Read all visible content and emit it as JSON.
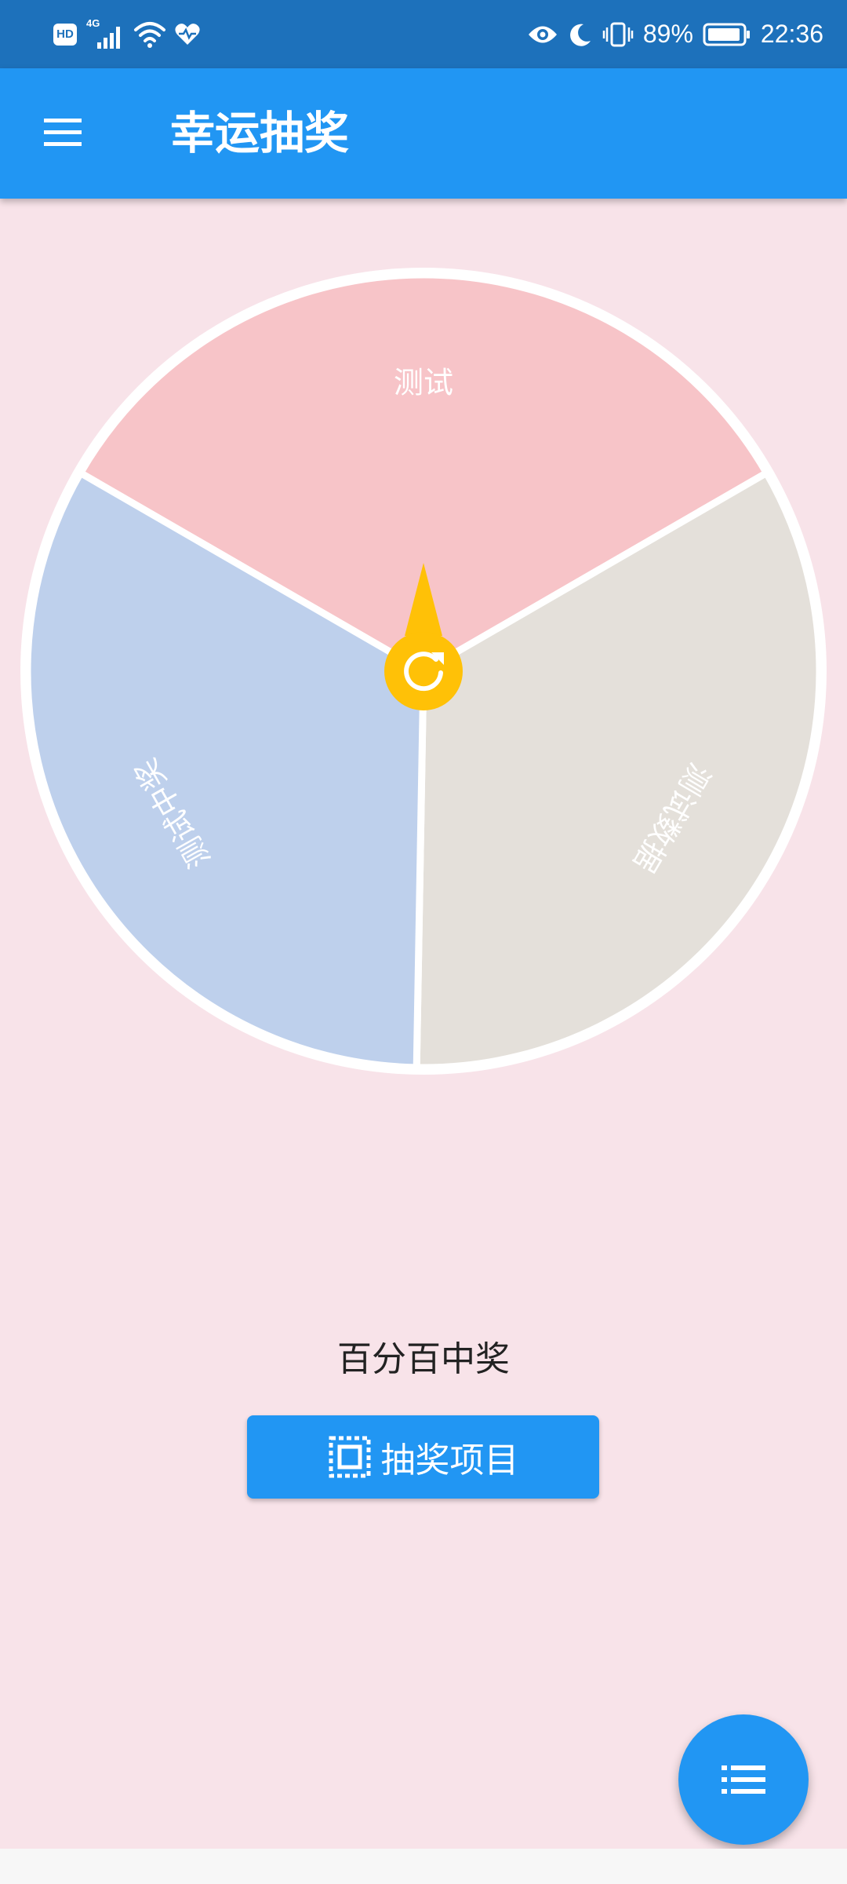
{
  "status_bar": {
    "hd_badge": "HD",
    "network": "4G",
    "battery_percent": "89%",
    "time": "22:36"
  },
  "app_bar": {
    "title": "幸运抽奖"
  },
  "wheel": {
    "segments": [
      {
        "label": "测试",
        "color": "#f7c4c8"
      },
      {
        "label": "测试数据",
        "color": "#e4e0da"
      },
      {
        "label": "测试中奖",
        "color": "#bed0ec"
      }
    ],
    "pointer_color": "#ffc107",
    "border_color": "#ffffff"
  },
  "result": {
    "text": "百分百中奖"
  },
  "button": {
    "label": "抽奖项目"
  },
  "colors": {
    "primary": "#2196f3",
    "status_bar": "#1d71bb",
    "background": "#f8e3e9"
  }
}
